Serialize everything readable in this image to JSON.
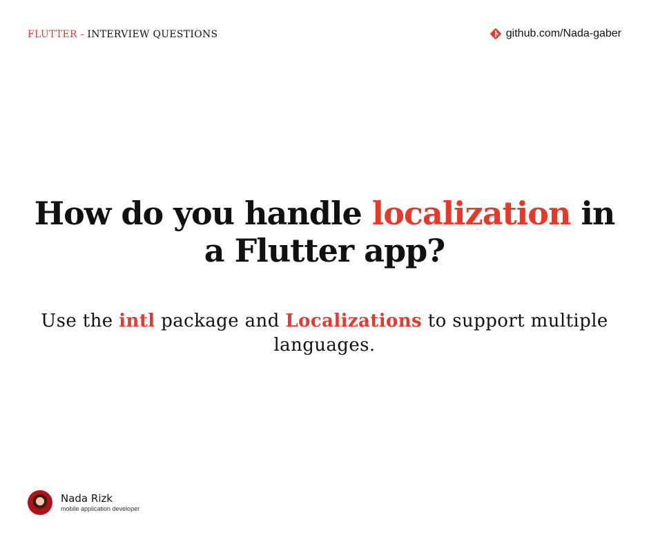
{
  "header": {
    "series_accent": "FLUTTER -",
    "series_rest": "INTERVIEW QUESTIONS",
    "github_text": "github.com/Nada-gaber",
    "github_icon": "git-icon"
  },
  "question": {
    "part1": "How do you handle",
    "highlight": "localization",
    "part2": "in a Flutter app?"
  },
  "answer": {
    "part1": "Use the",
    "highlight1": "intl",
    "part2": "package and",
    "highlight2": "Localizations",
    "part3": "to support multiple languages."
  },
  "author": {
    "name": "Nada Rizk",
    "role": "mobile application developer"
  },
  "colors": {
    "accent": "#e5392b",
    "text": "#111111",
    "background": "#ffffff"
  }
}
